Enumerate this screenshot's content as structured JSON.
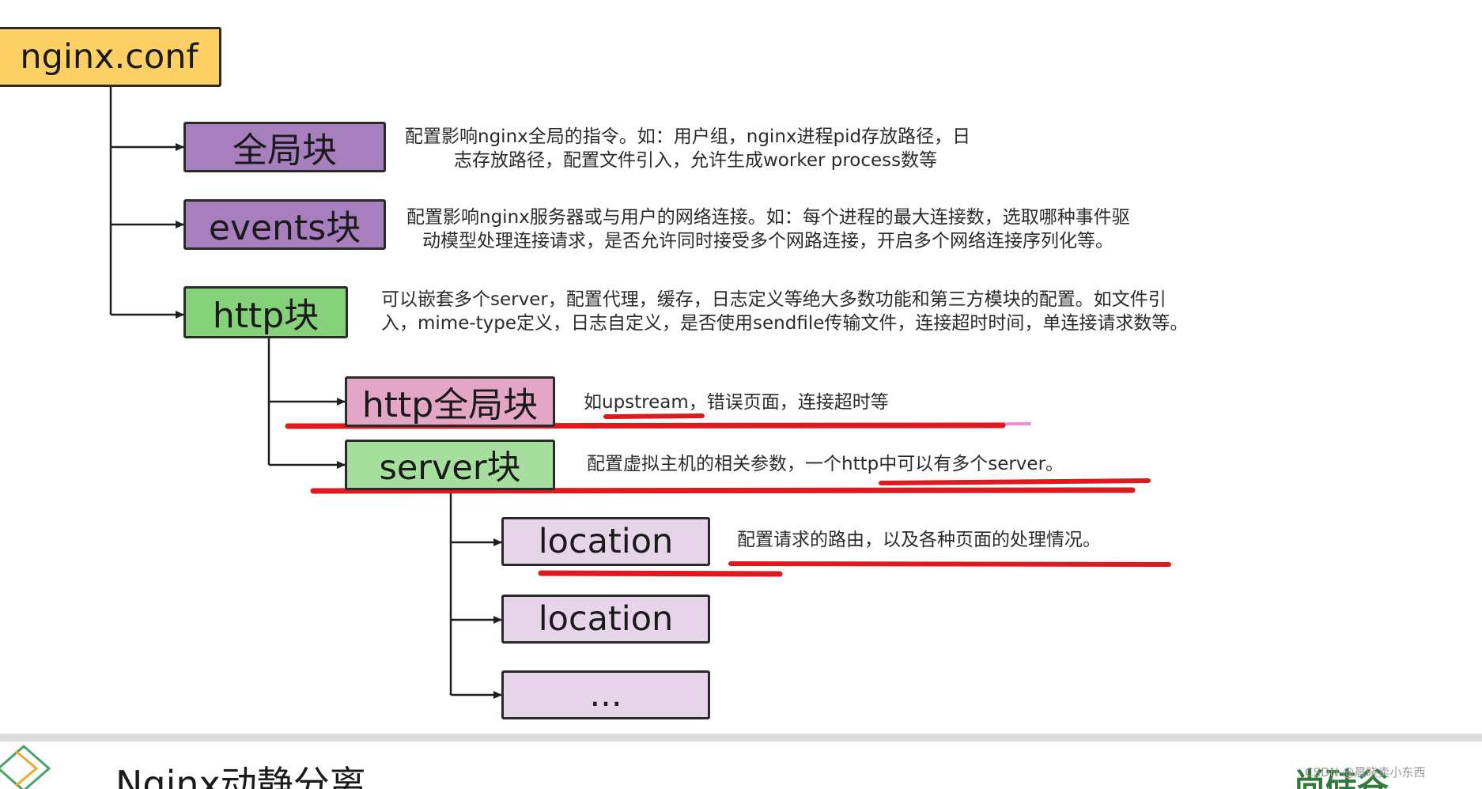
{
  "diagram": {
    "root": "nginx.conf",
    "blocks": {
      "global": "全局块",
      "events": "events块",
      "http": "http块",
      "http_global": "http全局块",
      "server": "server块",
      "location_1": "location",
      "location_2": "location",
      "ellipsis": "..."
    },
    "descriptions": {
      "global": [
        "配置影响nginx全局的指令。如：用户组，nginx进程pid存放路径，日",
        "志存放路径，配置文件引入，允许生成worker process数等"
      ],
      "events": [
        "配置影响nginx服务器或与用户的网络连接。如：每个进程的最大连接数，选取哪种事件驱",
        "动模型处理连接请求，是否允许同时接受多个网路连接，开启多个网络连接序列化等。"
      ],
      "http": [
        "可以嵌套多个server，配置代理，缓存，日志定义等绝大多数功能和第三方模块的配置。如文件引",
        "入，mime-type定义，日志自定义，是否使用sendfile传输文件，连接超时时间，单连接请求数等。"
      ],
      "http_global": "如upstream，错误页面，连接超时等",
      "server": "配置虚拟主机的相关参数，一个http中可以有多个server。",
      "location": "配置请求的路由，以及各种页面的处理情况。"
    }
  },
  "footer": {
    "title": "Nginx动静分离",
    "brand": "尚硅谷",
    "watermark": "CSDN @晨晓卖小东西"
  },
  "colors": {
    "root": "#fdd063",
    "purple": "#a77fbe",
    "green": "#85d27a",
    "pink": "#e3a6c6",
    "light_green": "#a6df9d",
    "lavender": "#e6d5e9",
    "annotation_red": "#e0191e",
    "annotation_pink": "#f28bd6",
    "connector": "#1f1f1f"
  },
  "icons": {
    "logo": "diamond-logo-icon",
    "brand": "brand-logo-icon"
  }
}
